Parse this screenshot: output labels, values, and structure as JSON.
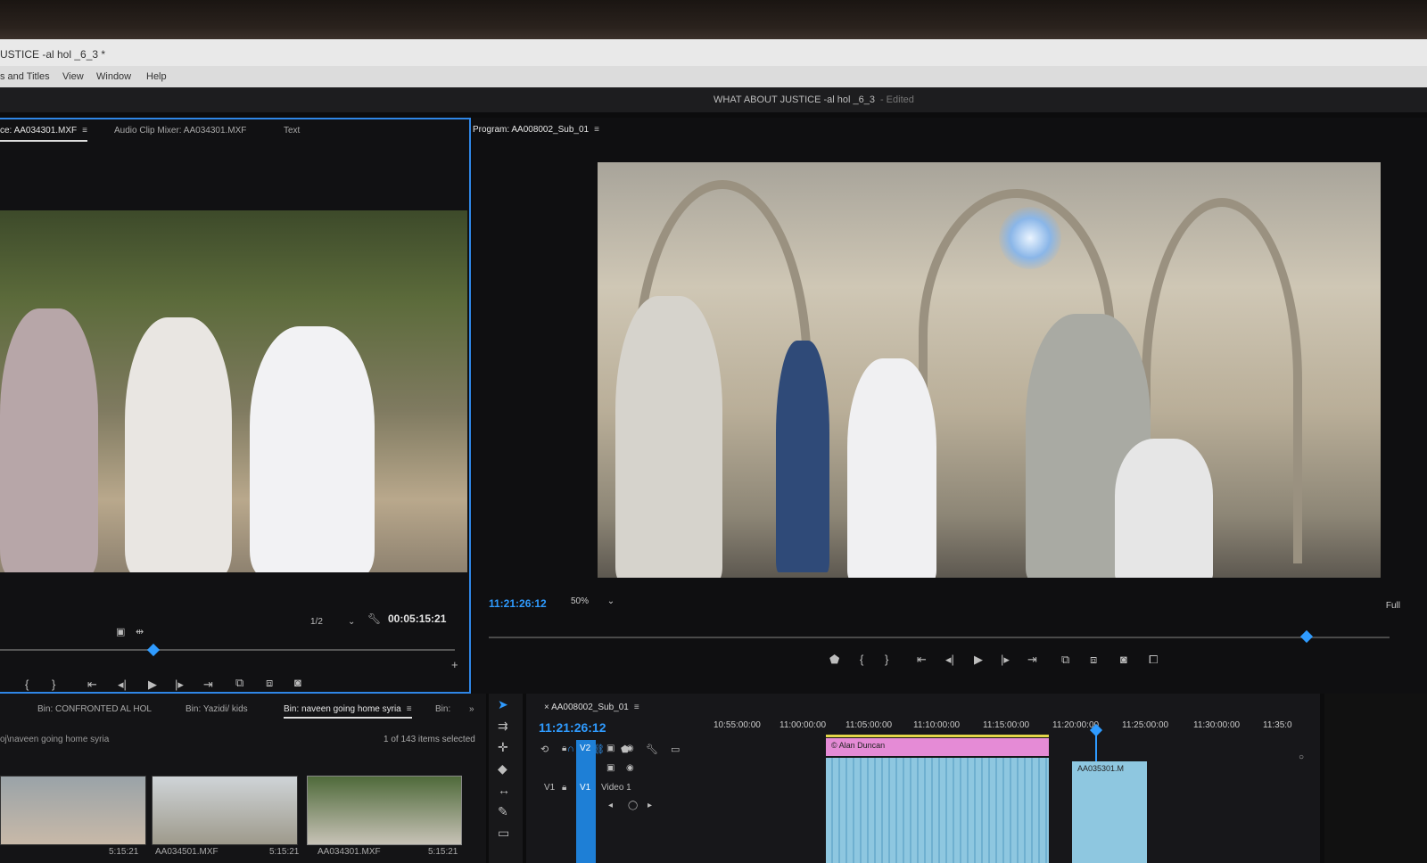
{
  "window": {
    "title": "USTICE -al hol _6_3 *",
    "menu": [
      "s and Titles",
      "View",
      "Window",
      "Help"
    ],
    "document": "WHAT ABOUT JUSTICE -al hol _6_3",
    "edited": "- Edited"
  },
  "source": {
    "tabs": [
      "ce: AA034301.MXF",
      "Audio Clip Mixer: AA034301.MXF",
      "Text"
    ],
    "ratio": "1/2",
    "timecode": "00:05:15:21"
  },
  "program": {
    "tab": "Program: AA008002_Sub_01",
    "timecode": "11:21:26:12",
    "zoom": "50%",
    "resolution": "Full"
  },
  "bins": {
    "tabs": [
      "Bin: CONFRONTED AL HOL",
      "Bin: Yazidi/ kids",
      "Bin: naveen going home syria",
      "Bin:"
    ],
    "path": "oj\\naveen going home syria",
    "count": "1 of 143 items selected",
    "items": [
      {
        "name": "",
        "duration": "5:15:21"
      },
      {
        "name": "AA034501.MXF",
        "duration": "5:15:21"
      },
      {
        "name": "AA034301.MXF",
        "duration": "5:15:21"
      }
    ]
  },
  "timeline": {
    "tab": "AA008002_Sub_01",
    "timecode": "11:21:26:12",
    "ruler": [
      "10:55:00:00",
      "11:00:00:00",
      "11:05:00:00",
      "11:10:00:00",
      "11:15:00:00",
      "11:20:00:00",
      "11:25:00:00",
      "11:30:00:00",
      "11:35:0"
    ],
    "tracks": {
      "v2": "V2",
      "v1_left": "V1",
      "v1": "V1",
      "v1_name": "Video 1"
    },
    "clips": {
      "title": "© Alan Duncan",
      "clip2": "AA035301.M"
    }
  },
  "colors": {
    "accent": "#2f86e6",
    "timecode": "#2f9bff",
    "title_clip": "#e58bd6",
    "video_clip": "#8ec7e0"
  }
}
